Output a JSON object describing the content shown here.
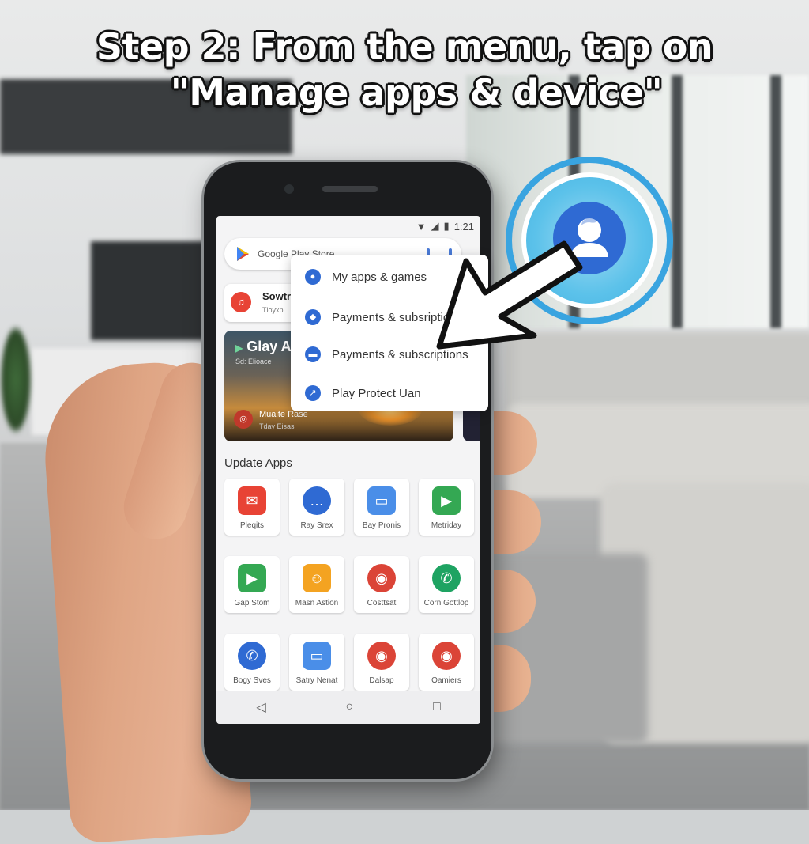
{
  "headline": {
    "line1": "Step 2: From the menu, tap on",
    "line2": "\"Manage apps & device\""
  },
  "status_bar": {
    "time": "1:21",
    "icons": [
      "wifi-icon",
      "signal-icon",
      "battery-icon"
    ]
  },
  "search_bar": {
    "text": "Google Play Store"
  },
  "featured_card": {
    "title": "Sowtr",
    "subtitle": "Tloyxpl"
  },
  "banner": {
    "title": "Glay A",
    "subtitle": "Sd: Elioace",
    "app_name": "Muaite Rase",
    "app_sub": "Tday Eisas"
  },
  "menu": {
    "items": [
      {
        "label": "My apps & games",
        "icon": "person-icon"
      },
      {
        "label": "Payments & subsription",
        "icon": "shield-icon"
      },
      {
        "label": "Payments & subscriptions",
        "icon": "card-icon"
      },
      {
        "label": "Play Protect Uan",
        "icon": "protect-icon"
      }
    ]
  },
  "section_title": "Update Apps",
  "apps": [
    {
      "label": "Pleqits",
      "icon": "gmail-icon",
      "color": "#e84335"
    },
    {
      "label": "Ray Srex",
      "icon": "chat-icon",
      "color": "#2f6ad3"
    },
    {
      "label": "Bay Pronis",
      "icon": "message-icon",
      "color": "#4a8ee8"
    },
    {
      "label": "Metriday",
      "icon": "play-icon",
      "color": "#34a853"
    },
    {
      "label": "Gap Stom",
      "icon": "play-icon",
      "color": "#34a853"
    },
    {
      "label": "Masn Astion",
      "icon": "people-icon",
      "color": "#f4a321"
    },
    {
      "label": "Costtsat",
      "icon": "chrome-icon",
      "color": "#db4437"
    },
    {
      "label": "Corn Gottlop",
      "icon": "phone-icon",
      "color": "#1ea362"
    },
    {
      "label": "Bogy Sves",
      "icon": "phone-icon",
      "color": "#2f6ad3"
    },
    {
      "label": "Satry Nenat",
      "icon": "message-icon",
      "color": "#4a8ee8"
    },
    {
      "label": "Dalsap",
      "icon": "chrome-icon",
      "color": "#db4437"
    },
    {
      "label": "Oamiers",
      "icon": "chrome-icon",
      "color": "#db4437"
    }
  ],
  "nav": {
    "back": "◁",
    "home": "○",
    "recents": "□"
  },
  "colors": {
    "accent": "#2f6ad3",
    "ring": "#39a4e0"
  }
}
